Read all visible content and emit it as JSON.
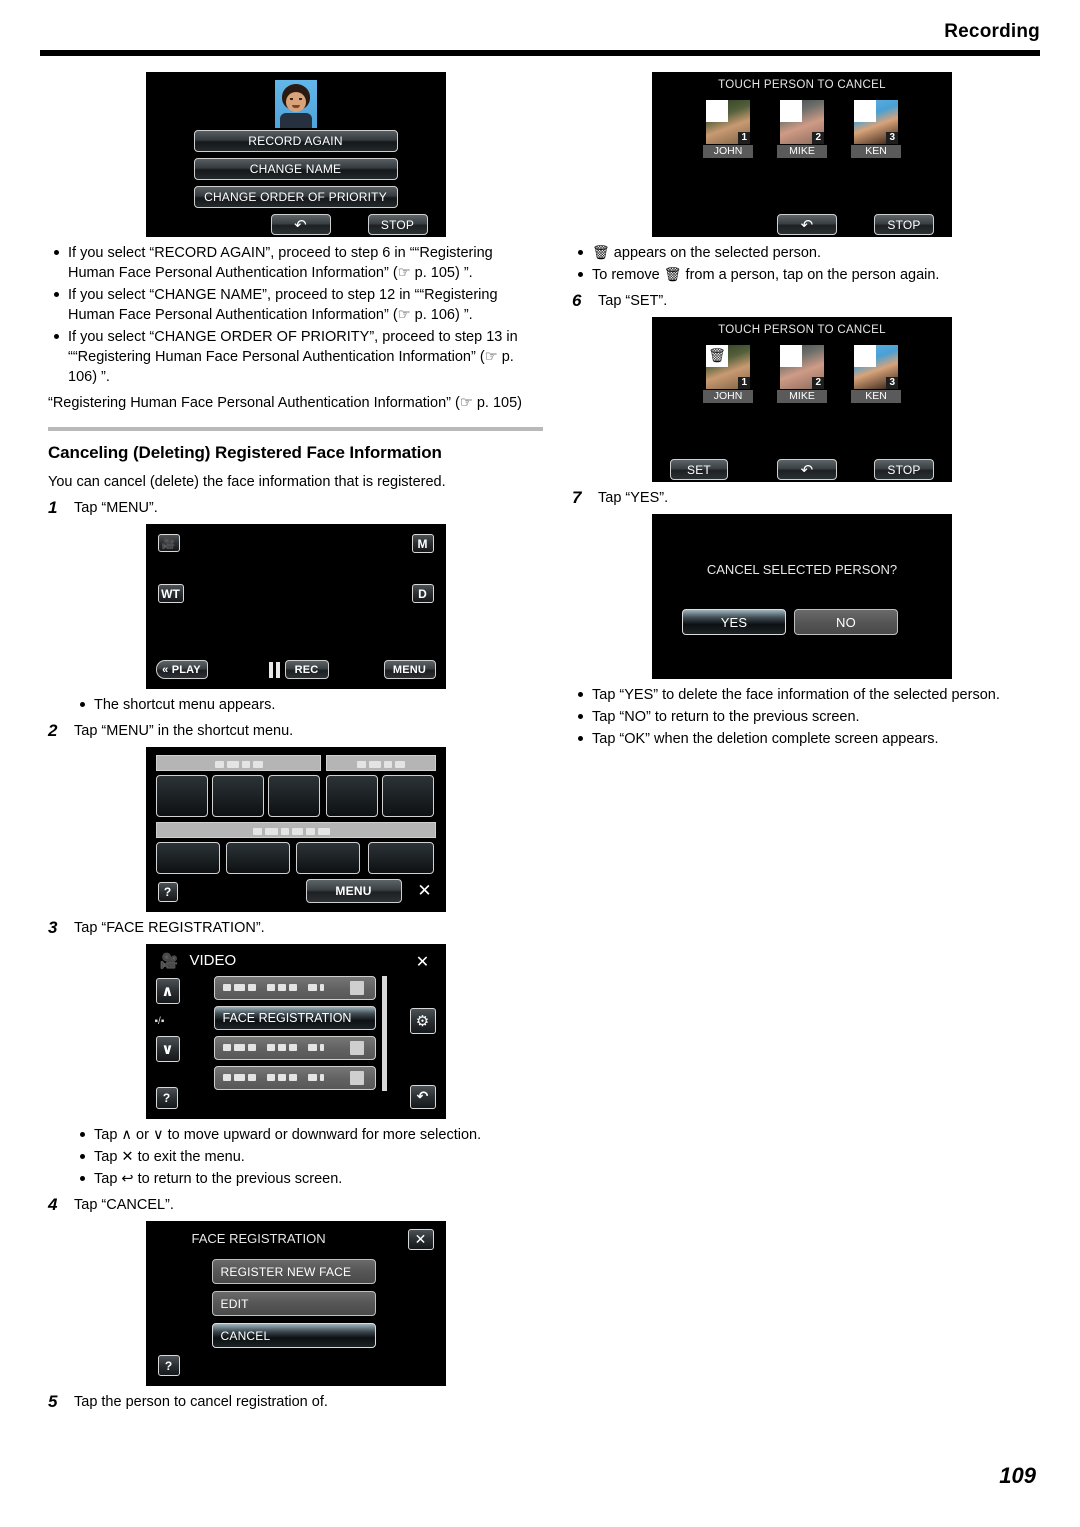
{
  "header": {
    "title": "Recording"
  },
  "page_number": "109",
  "left_column": {
    "screen_edit_person": {
      "name": "edit-person-screen",
      "buttons": [
        "RECORD AGAIN",
        "CHANGE NAME",
        "CHANGE ORDER OF PRIORITY"
      ],
      "back_icon": "return-arrow-icon",
      "stop_label": "STOP"
    },
    "bullets_top": [
      "If you select “RECORD AGAIN”, proceed to step 6 in ““Registering Human Face Personal Authentication Information” (☞ p. 105) ”.",
      "If you select “CHANGE NAME”, proceed to step 12 in ““Registering Human Face Personal Authentication Information” (☞ p. 106) ”.",
      "If you select “CHANGE ORDER OF PRIORITY”, proceed to step 13 in ““Registering Human Face Personal Authentication Information” (☞ p. 106) ”."
    ],
    "note_after_bullets": "“Registering Human Face Personal Authentication Information” (☞ p. 105)",
    "section_heading": "Canceling (Deleting) Registered Face Information",
    "intro": "You can cancel (delete) the face information that is registered.",
    "step1": {
      "num": "1",
      "text": "Tap “MENU”."
    },
    "screen_rec": {
      "name": "record-standby-screen",
      "icon_camera": "video-camera-icon",
      "icon_m": "M",
      "icon_wt": "WT",
      "icon_d": "D",
      "play_label": "« PLAY",
      "rec_label": "REC",
      "menu_label": "MENU"
    },
    "bullet_step1": "The shortcut menu appears.",
    "step2": {
      "num": "2",
      "text": "Tap “MENU” in the shortcut menu."
    },
    "screen_shortcut": {
      "name": "shortcut-menu-screen",
      "help_label": "?",
      "menu_label": "MENU",
      "close_icon": "close-icon"
    },
    "step3": {
      "num": "3",
      "text": "Tap “FACE REGISTRATION”."
    },
    "screen_video_menu": {
      "name": "video-menu-screen",
      "title": "VIDEO",
      "selected_item": "FACE REGISTRATION",
      "up_icon": "chevron-up-icon",
      "down_icon": "chevron-down-icon",
      "page_indicator": "▪/▪",
      "help_label": "?",
      "close_icon": "close-icon",
      "gear_icon": "gear-icon",
      "back_icon": "return-arrow-icon"
    },
    "bullets_step3": [
      "Tap ∧ or ∨ to move upward or downward for more selection.",
      "Tap ✕ to exit the menu.",
      "Tap ↩ to return to the previous screen."
    ],
    "step4": {
      "num": "4",
      "text": "Tap “CANCEL”."
    },
    "screen_face_registration": {
      "name": "face-registration-screen",
      "title": "FACE REGISTRATION",
      "buttons": [
        "REGISTER NEW FACE",
        "EDIT",
        "CANCEL"
      ],
      "selected": "CANCEL",
      "help_label": "?",
      "close_icon": "close-icon"
    },
    "step5": {
      "num": "5",
      "text": "Tap the person to cancel registration of."
    }
  },
  "right_column": {
    "screen_touch_cancel": {
      "name": "touch-person-to-cancel-screen",
      "title": "TOUCH PERSON TO CANCEL",
      "people": [
        {
          "name": "JOHN",
          "index": "1",
          "selected": false
        },
        {
          "name": "MIKE",
          "index": "2",
          "selected": false
        },
        {
          "name": "KEN",
          "index": "3",
          "selected": false
        }
      ],
      "back_icon": "return-arrow-icon",
      "stop_label": "STOP"
    },
    "bullets_step5": [
      "Ὕ1 appears on the selected person.",
      "To remove Ὕ1 from a person, tap on the person again."
    ],
    "bullet5_1_prefix": "",
    "bullet5_1_suffix": " appears on the selected person.",
    "bullet5_2_prefix": "To remove ",
    "bullet5_2_suffix": " from a person, tap on the person again.",
    "step6": {
      "num": "6",
      "text": "Tap “SET”."
    },
    "screen_touch_cancel_set": {
      "name": "touch-person-to-cancel-set-screen",
      "title": "TOUCH PERSON TO CANCEL",
      "people": [
        {
          "name": "JOHN",
          "index": "1",
          "selected": true
        },
        {
          "name": "MIKE",
          "index": "2",
          "selected": false
        },
        {
          "name": "KEN",
          "index": "3",
          "selected": false
        }
      ],
      "set_label": "SET",
      "back_icon": "return-arrow-icon",
      "stop_label": "STOP"
    },
    "step7": {
      "num": "7",
      "text": "Tap “YES”."
    },
    "screen_confirm": {
      "name": "cancel-confirm-screen",
      "message": "CANCEL SELECTED PERSON?",
      "yes_label": "YES",
      "no_label": "NO"
    },
    "bullets_step7": [
      "Tap “YES” to delete the face information of the selected person.",
      "Tap “NO” to return to the previous screen.",
      "Tap “OK” when the deletion complete screen appears."
    ]
  }
}
